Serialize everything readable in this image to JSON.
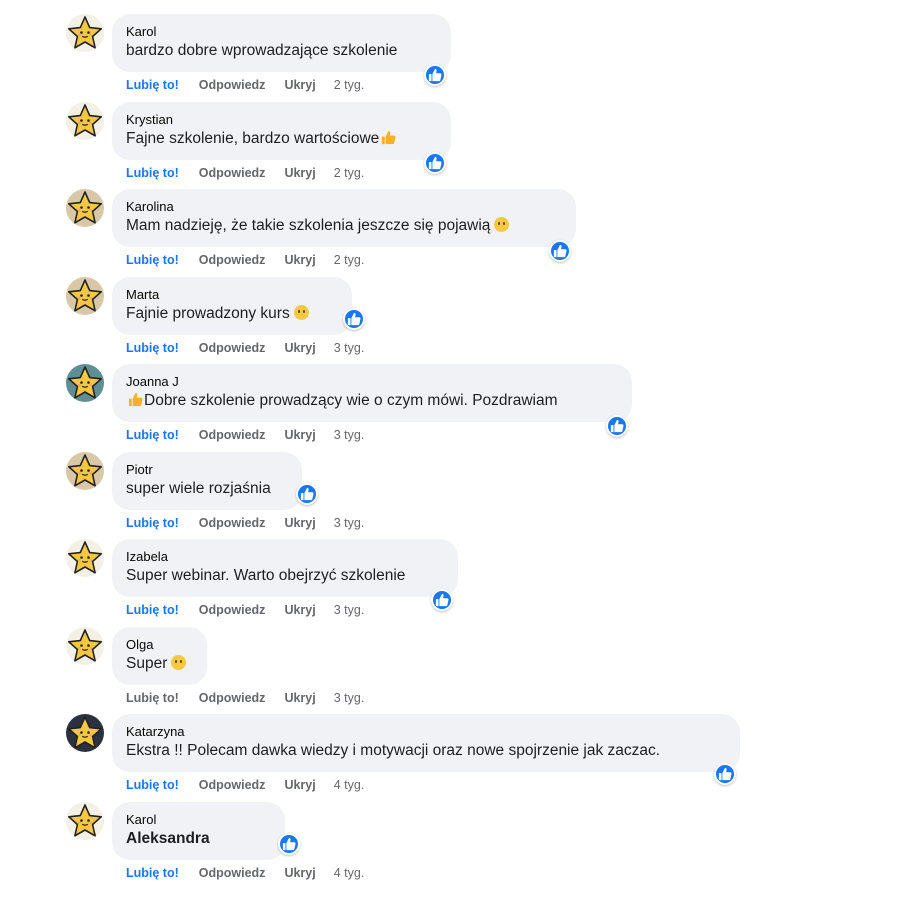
{
  "comments": [
    {
      "author": "Karol",
      "text": "bardzo dobre wprowadzające szkolenie",
      "like_label": "Lubię to!",
      "liked": true,
      "reply_label": "Odpowiedz",
      "hide_label": "Ukryj",
      "time": "2 tyg.",
      "emoji": "",
      "avatar_color": "#f3f0e6"
    },
    {
      "author": "Krystian",
      "text": "Fajne szkolenie, bardzo wartościowe",
      "like_label": "Lubię to!",
      "liked": true,
      "reply_label": "Odpowiedz",
      "hide_label": "Ukryj",
      "time": "2 tyg.",
      "emoji": "thumbs-up",
      "avatar_color": "#f3f0e6"
    },
    {
      "author": "Karolina",
      "text": "Mam nadzieję, że takie szkolenia jeszcze się pojawią",
      "like_label": "Lubię to!",
      "liked": true,
      "reply_label": "Odpowiedz",
      "hide_label": "Ukryj",
      "time": "2 tyg.",
      "emoji": "sad-face",
      "avatar_color": "#d8c8a8"
    },
    {
      "author": "Marta",
      "text": "Fajnie prowadzony kurs",
      "like_label": "Lubię to!",
      "liked": true,
      "reply_label": "Odpowiedz",
      "hide_label": "Ukryj",
      "time": "3 tyg.",
      "emoji": "smile-face",
      "avatar_color": "#d8c8a8"
    },
    {
      "author": "Joanna J",
      "text": "Dobre szkolenie prowadzący wie o czym mówi. Pozdrawiam",
      "like_label": "Lubię to!",
      "liked": true,
      "reply_label": "Odpowiedz",
      "hide_label": "Ukryj",
      "time": "3 tyg.",
      "emoji": "thumbs-up",
      "avatar_color": "#5f8f92"
    },
    {
      "author": "Piotr",
      "text": "super wiele rozjaśnia",
      "like_label": "Lubię to!",
      "liked": true,
      "reply_label": "Odpowiedz",
      "hide_label": "Ukryj",
      "time": "3 tyg.",
      "emoji": "",
      "avatar_color": "#d8c8a8"
    },
    {
      "author": "Izabela",
      "text": "Super webinar. Warto obejrzyć szkolenie",
      "like_label": "Lubię to!",
      "liked": true,
      "reply_label": "Odpowiedz",
      "hide_label": "Ukryj",
      "time": "3 tyg.",
      "emoji": "",
      "avatar_color": "#f3f0e6"
    },
    {
      "author": "Olga",
      "text": "Super",
      "like_label": "Lubię to!",
      "liked": false,
      "reply_label": "Odpowiedz",
      "hide_label": "Ukryj",
      "time": "3 tyg.",
      "emoji": "wink-face",
      "avatar_color": "#f3f0e6"
    },
    {
      "author": "Katarzyna",
      "text": "Ekstra !! Polecam dawka wiedzy i motywacji oraz nowe spojrzenie jak zaczac.",
      "like_label": "Lubię to!",
      "liked": true,
      "reply_label": "Odpowiedz",
      "hide_label": "Ukryj",
      "time": "4 tyg.",
      "emoji": "",
      "avatar_color": "#2c3140"
    },
    {
      "author": "Karol",
      "text": "Aleksandra",
      "like_label": "Lubię to!",
      "liked": true,
      "reply_label": "Odpowiedz",
      "hide_label": "Ukryj",
      "time": "4 tyg.",
      "emoji": "",
      "avatar_color": "#f3f0e6",
      "mention": true
    }
  ],
  "colors": {
    "accent": "#1877f2",
    "bubble": "#f0f2f5",
    "muted": "#65676b",
    "text": "#050505"
  },
  "icons": {
    "avatar": "star-face-icon",
    "like_badge": "thumbs-up-icon"
  }
}
